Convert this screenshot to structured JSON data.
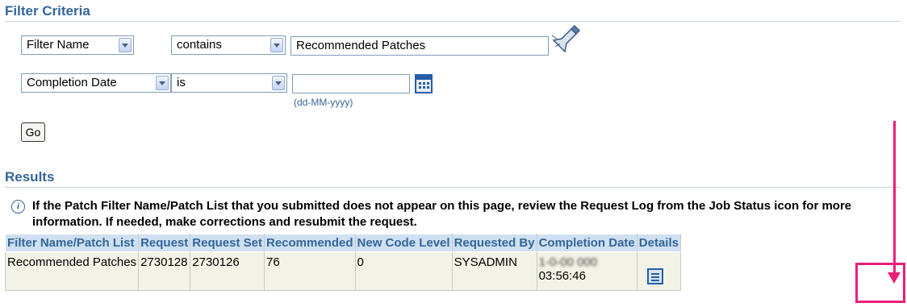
{
  "filter_section": {
    "title": "Filter Criteria",
    "row1": {
      "field_select": "Filter Name",
      "operator_select": "contains",
      "value_input": "Recommended Patches"
    },
    "row2": {
      "field_select": "Completion Date",
      "operator_select": "is",
      "value_input": "",
      "date_hint": "(dd-MM-yyyy)"
    },
    "go_label": "Go"
  },
  "results_section": {
    "title": "Results",
    "info_text": "If the Patch Filter Name/Patch List that you submitted does not appear on this page, review the Request Log from the Job Status icon for more information. If needed, make corrections and resubmit the request.",
    "columns": [
      "Filter Name/Patch List",
      "Request",
      "Request Set",
      "Recommended",
      "New Code Level",
      "Requested By",
      "Completion Date",
      "Details"
    ],
    "rows": [
      {
        "filter_name": "Recommended Patches",
        "request": "2730128",
        "request_set": "2730126",
        "recommended": "76",
        "new_code_level": "0",
        "requested_by": "SYSADMIN",
        "completion_date_line1": "1-0-00 000",
        "completion_date_line2": "03:56:46"
      }
    ]
  },
  "icons": {
    "flashlight": "flashlight-icon",
    "calendar": "calendar-icon",
    "info": "info-icon",
    "details": "details-icon"
  },
  "colors": {
    "header_text": "#336699",
    "table_header_bg": "#cfe0f1",
    "row_bg": "#f2f2e6",
    "callout": "#ec1e79"
  }
}
